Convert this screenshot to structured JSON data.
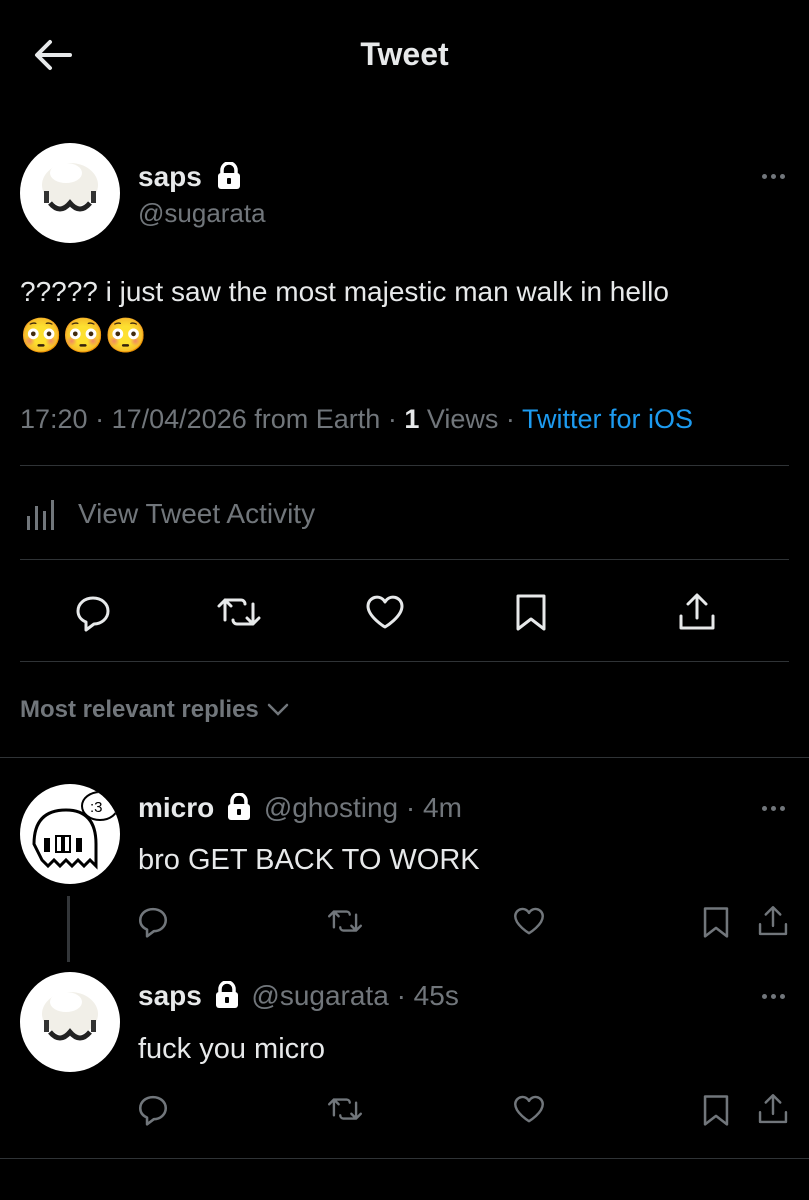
{
  "header": {
    "title": "Tweet",
    "back_icon": "arrow-left-icon"
  },
  "tweet": {
    "display_name": "saps",
    "handle": "@sugarata",
    "text": "????? i just saw the most majestic man walk in hello",
    "emoji": "😳😳😳",
    "time": "17:20",
    "date": "17/04/2026",
    "location": "from Earth",
    "views_count": "1",
    "views_label": "Views",
    "source": "Twitter for iOS",
    "activity_label": "View Tweet Activity"
  },
  "replies_header": {
    "label": "Most relevant replies"
  },
  "replies": [
    {
      "display_name": "micro",
      "handle": "@ghosting",
      "time": "4m",
      "text": "bro GET BACK TO WORK"
    },
    {
      "display_name": "saps",
      "handle": "@sugarata",
      "time": "45s",
      "text": "fuck you micro"
    }
  ],
  "colors": {
    "background": "#000000",
    "text": "#e7e9ea",
    "muted": "#71767b",
    "link": "#1d9bf0",
    "divider": "#2f3336"
  }
}
